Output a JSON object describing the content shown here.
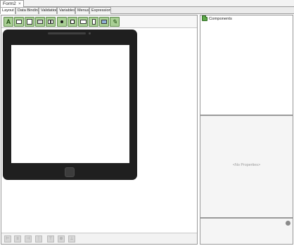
{
  "document_tab": {
    "label": "Form2",
    "close_glyph": "×"
  },
  "sub_tabs": [
    {
      "label": "Layout",
      "active": true
    },
    {
      "label": "Data Binding",
      "active": false
    },
    {
      "label": "Validation",
      "active": false
    },
    {
      "label": "Variables",
      "active": false
    },
    {
      "label": "Menus",
      "active": false
    },
    {
      "label": "Expressions",
      "active": false
    }
  ],
  "toolbar": {
    "tools": [
      {
        "name": "label-tool-icon",
        "glyph": "A"
      },
      {
        "name": "textbox-tool-icon",
        "glyph": ""
      },
      {
        "name": "textarea-tool-icon",
        "glyph": ""
      },
      {
        "name": "button-tool-icon",
        "glyph": ""
      },
      {
        "name": "panel-tool-icon",
        "glyph": ""
      },
      {
        "name": "radio-tool-icon",
        "glyph": ""
      },
      {
        "name": "checkbox-tool-icon",
        "glyph": ""
      },
      {
        "name": "dropdown-tool-icon",
        "glyph": ""
      },
      {
        "name": "list-tool-icon",
        "glyph": ""
      },
      {
        "name": "image-tool-icon",
        "glyph": ""
      },
      {
        "name": "signature-tool-icon",
        "glyph": ""
      }
    ]
  },
  "components_panel": {
    "title": "Components"
  },
  "properties_panel": {
    "empty_text": "<No Properties>"
  },
  "bottom_toolbar": {
    "buttons": [
      "align-left-icon",
      "align-center-icon",
      "align-right-icon",
      "distribute-icon",
      "align-top-icon",
      "align-middle-icon",
      "align-bottom-icon"
    ]
  }
}
